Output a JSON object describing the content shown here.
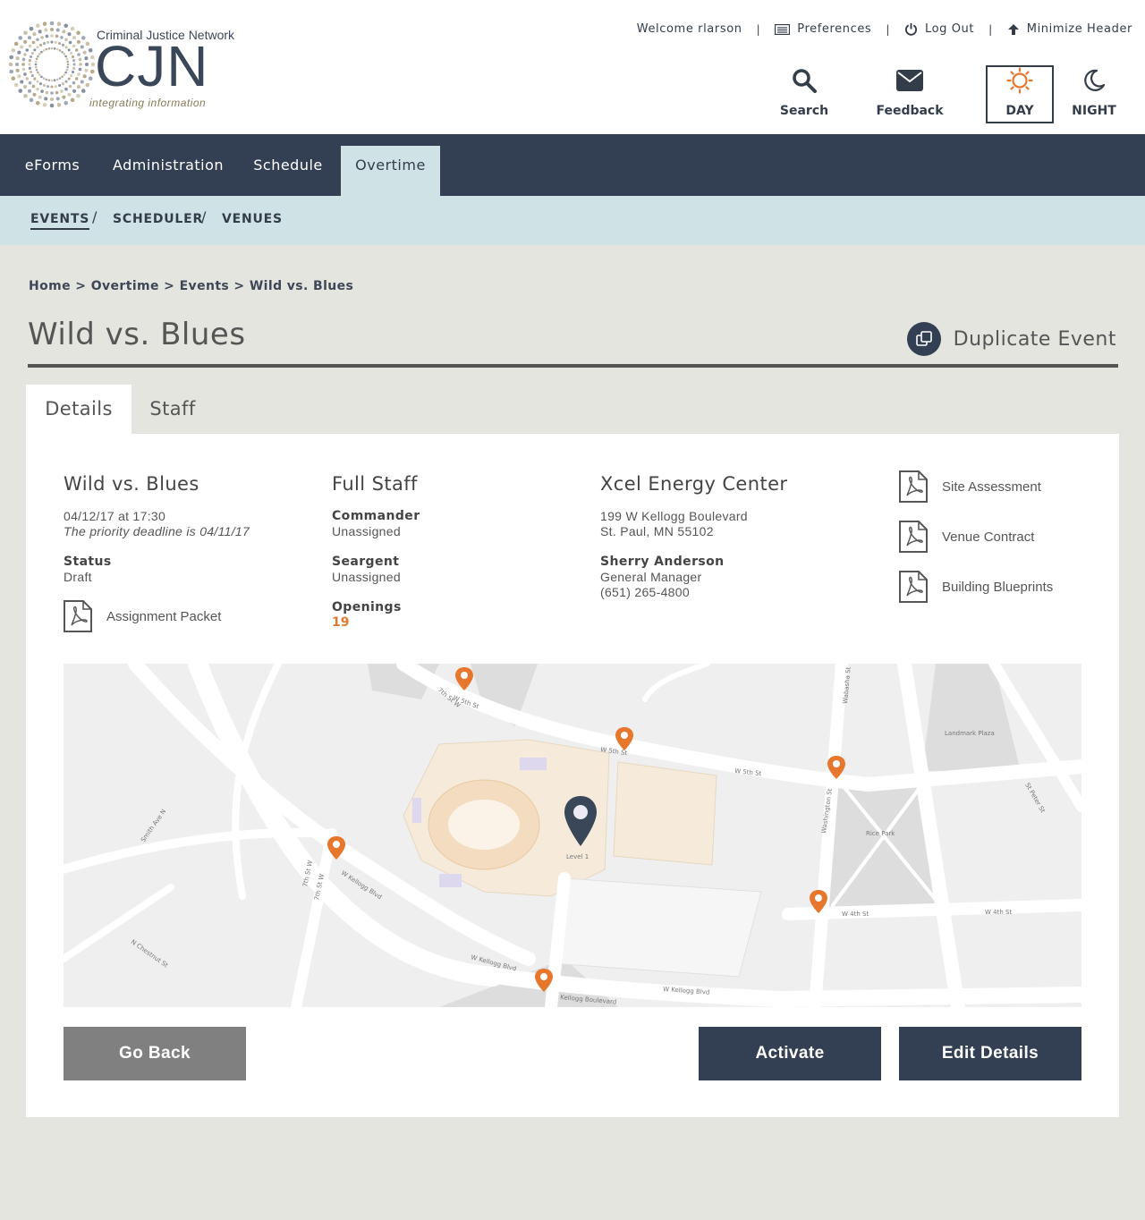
{
  "logo": {
    "org_name": "Criminal Justice Network",
    "abbr": "CJN",
    "tagline": "integrating information"
  },
  "top_links": {
    "welcome": "Welcome rlarson",
    "preferences": "Preferences",
    "logout": "Log Out",
    "minimize": "Minimize Header"
  },
  "header_buttons": {
    "search": "Search",
    "feedback": "Feedback",
    "day": "DAY",
    "night": "NIGHT"
  },
  "main_nav": [
    {
      "label": "eForms"
    },
    {
      "label": "Administration"
    },
    {
      "label": "Schedule"
    },
    {
      "label": "Overtime",
      "active": true
    }
  ],
  "sub_nav": [
    {
      "label": "EVENTS",
      "active": true
    },
    {
      "label": "SCHEDULER"
    },
    {
      "label": "VENUES"
    }
  ],
  "breadcrumb": "Home > Overtime > Events > Wild vs. Blues",
  "page_title": "Wild vs. Blues",
  "duplicate_label": "Duplicate Event",
  "tabs": [
    {
      "label": "Details",
      "active": true
    },
    {
      "label": "Staff"
    }
  ],
  "event": {
    "title": "Wild vs. Blues",
    "datetime": "04/12/17 at 17:30",
    "deadline": "The priority deadline is 04/11/17",
    "status_label": "Status",
    "status_value": "Draft",
    "packet": "Assignment Packet"
  },
  "staff": {
    "title": "Full Staff",
    "commander_label": "Commander",
    "commander_value": "Unassigned",
    "sergeant_label": "Seargent",
    "sergeant_value": "Unassigned",
    "openings_label": "Openings",
    "openings_value": "19"
  },
  "venue": {
    "name": "Xcel Energy Center",
    "address1": "199 W Kellogg Boulevard",
    "address2": "St. Paul, MN 55102",
    "contact_name": "Sherry Anderson",
    "contact_title": "General Manager",
    "contact_phone": "(651) 265-4800"
  },
  "documents": [
    {
      "label": "Site Assessment"
    },
    {
      "label": "Venue Contract"
    },
    {
      "label": "Building Blueprints"
    }
  ],
  "map": {
    "streets": {
      "w5th_a": "W 5th St",
      "w5th_b": "W 5th St",
      "w5th_c": "W 5th St",
      "w4th_a": "W 4th St",
      "w4th_b": "W 4th St",
      "kellogg_a": "W Kellogg Blvd",
      "kellogg_b": "W Kellogg Blvd",
      "kellogg_c": "Kellogg Boulevard",
      "kellogg_d": "W Kellogg Blvd",
      "seventh_a": "7th St W",
      "seventh_b": "7th St W",
      "seventh_c": "7th St W",
      "washington": "Washington St",
      "wabasha": "Wabasha St",
      "st_peter": "St Peter St",
      "rice_park": "Rice Park",
      "landmark": "Landmark Plaza",
      "chestnut": "N Chestnut St",
      "smith": "Smith Ave N",
      "level": "Level 1"
    },
    "pin_color_orange": "#e8772e",
    "pin_color_main": "#3a4759"
  },
  "buttons": {
    "back": "Go Back",
    "activate": "Activate",
    "edit": "Edit Details"
  },
  "colors": {
    "navy": "#333f52",
    "accent_orange": "#e07a2e",
    "subnav_bg": "#cfe3e6",
    "page_bg": "#e5e5e0"
  }
}
